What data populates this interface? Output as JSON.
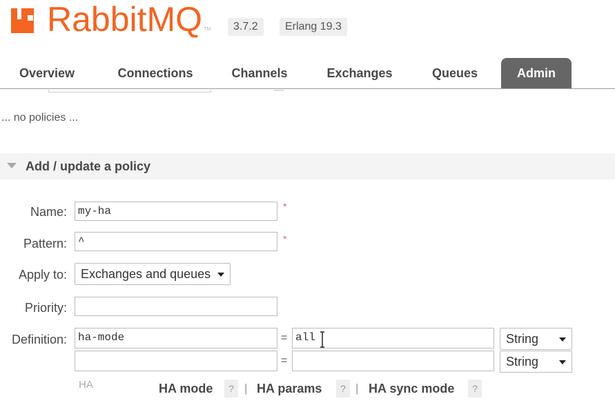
{
  "brand": {
    "name": "RabbitMQ",
    "tm": "TM",
    "color": "#f26522"
  },
  "versions": {
    "rabbitmq": "3.7.2",
    "erlang": "Erlang 19.3"
  },
  "nav": {
    "tabs": [
      {
        "label": "Overview"
      },
      {
        "label": "Connections"
      },
      {
        "label": "Channels"
      },
      {
        "label": "Exchanges"
      },
      {
        "label": "Queues"
      },
      {
        "label": "Admin",
        "active": true
      }
    ]
  },
  "policies": {
    "empty_text": "... no policies ..."
  },
  "section": {
    "title": "Add / update a policy"
  },
  "form": {
    "name": {
      "label": "Name:",
      "value": "my-ha",
      "required": "*"
    },
    "pattern": {
      "label": "Pattern:",
      "value": "^",
      "required": "*"
    },
    "apply_to": {
      "label": "Apply to:",
      "value": "Exchanges and queues"
    },
    "priority": {
      "label": "Priority:",
      "value": ""
    },
    "definition": {
      "label": "Definition:",
      "rows": [
        {
          "key": "ha-mode",
          "eq": "=",
          "value": "all",
          "type": "String"
        },
        {
          "key": "",
          "eq": "=",
          "value": "",
          "type": "String"
        }
      ]
    }
  },
  "help": {
    "prefix": "HA",
    "links": [
      {
        "label": "HA mode",
        "q": "?"
      },
      {
        "label": "HA params",
        "q": "?"
      },
      {
        "label": "HA sync mode",
        "q": "?"
      }
    ],
    "separator": "|"
  }
}
